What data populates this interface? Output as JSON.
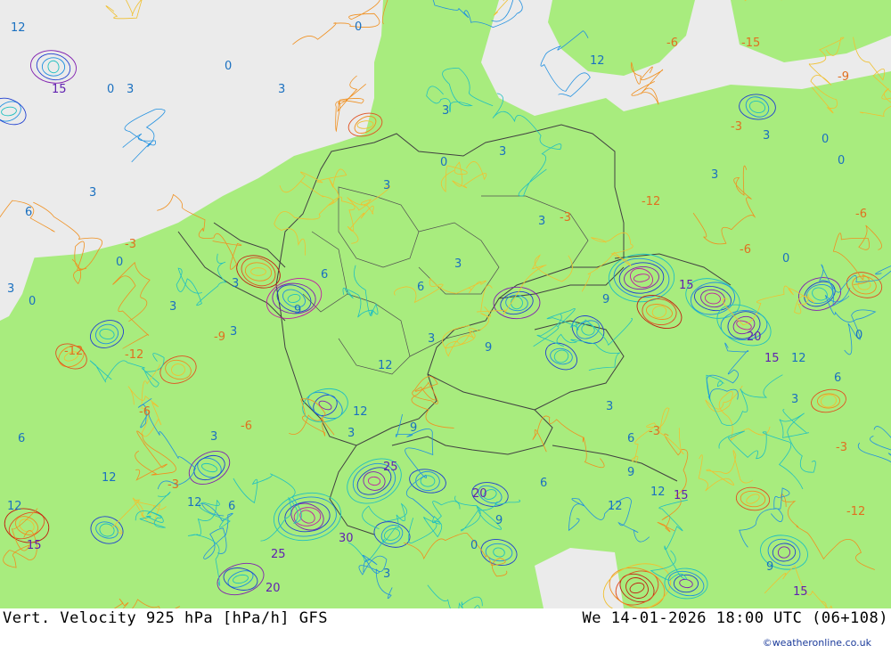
{
  "title": {
    "left": "Vert. Velocity 925 hPa [hPa/h] GFS",
    "right": "We 14-01-2026 18:00 UTC (06+108)"
  },
  "credit": "©weatheronline.co.uk",
  "colors": {
    "land_fill": "#a8ec7e",
    "sea_fill": "#ebebeb",
    "borders": "#404040",
    "negative_contours": [
      "#f0c030",
      "#f09020",
      "#e05020",
      "#c02010"
    ],
    "positive_contours": [
      "#20c0c0",
      "#2090e0",
      "#2040d0",
      "#8020b0",
      "#c020a0"
    ]
  },
  "contour_labels": [
    "0",
    "3",
    "6",
    "9",
    "12",
    "15",
    "20",
    "25",
    "30",
    "-3",
    "-6",
    "-9",
    "-12",
    "-15"
  ]
}
